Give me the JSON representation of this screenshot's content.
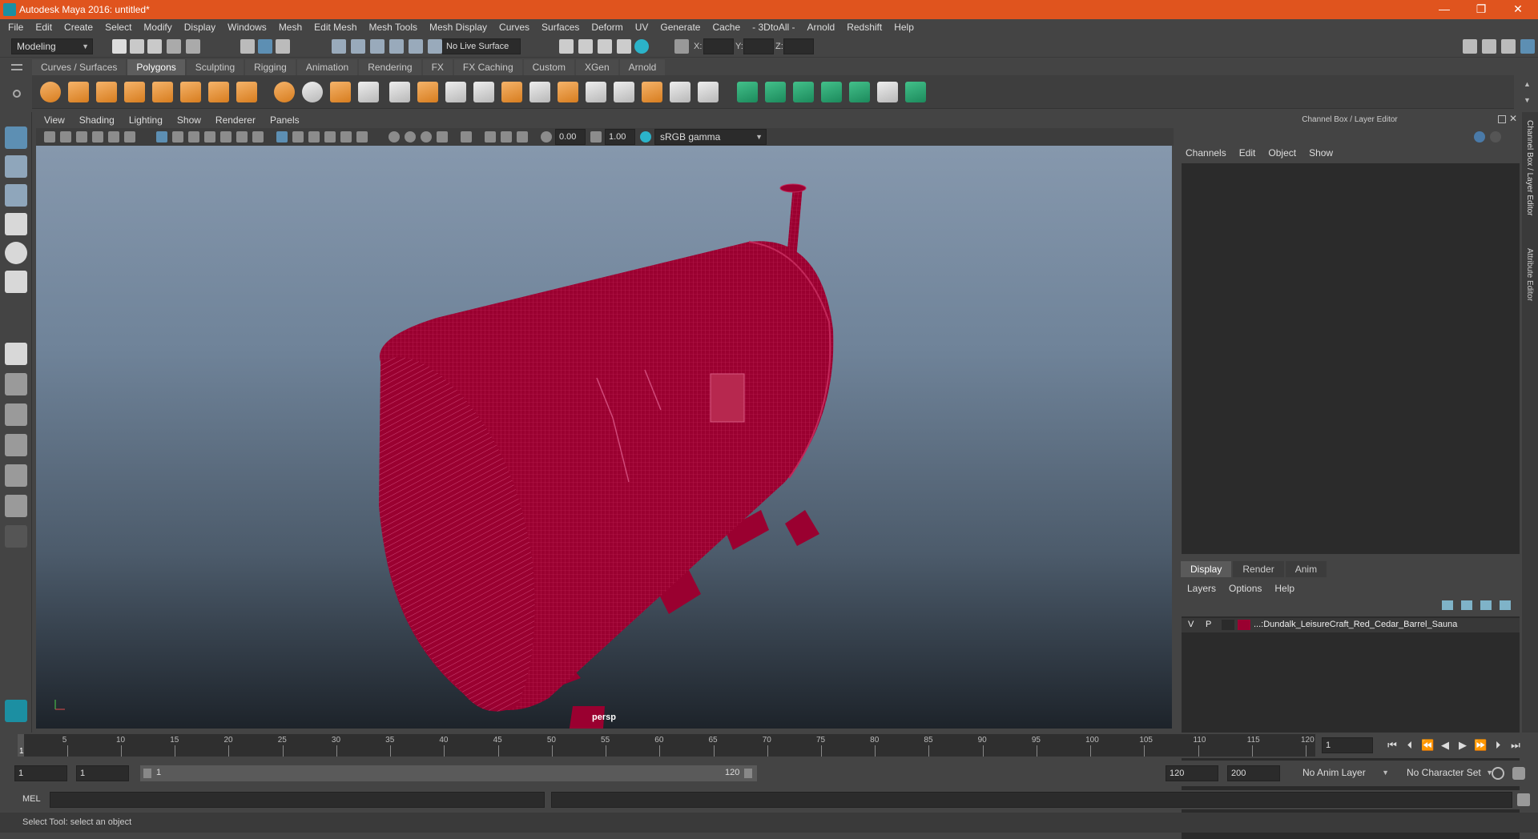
{
  "window": {
    "title": "Autodesk Maya 2016: untitled*",
    "minimize": "—",
    "restore": "❐",
    "close": "✕"
  },
  "menubar": [
    "File",
    "Edit",
    "Create",
    "Select",
    "Modify",
    "Display",
    "Windows",
    "Mesh",
    "Edit Mesh",
    "Mesh Tools",
    "Mesh Display",
    "Curves",
    "Surfaces",
    "Deform",
    "UV",
    "Generate",
    "Cache",
    "- 3DtoAll -",
    "Arnold",
    "Redshift",
    "Help"
  ],
  "statusline": {
    "mode": "Modeling",
    "live_surface": "No Live Surface",
    "x_label": "X:",
    "y_label": "Y:",
    "z_label": "Z:"
  },
  "shelf_tabs": [
    "Curves / Surfaces",
    "Polygons",
    "Sculpting",
    "Rigging",
    "Animation",
    "Rendering",
    "FX",
    "FX Caching",
    "Custom",
    "XGen",
    "Arnold"
  ],
  "shelf_active": "Polygons",
  "viewport": {
    "menus": [
      "View",
      "Shading",
      "Lighting",
      "Show",
      "Renderer",
      "Panels"
    ],
    "exposure": "0.00",
    "gamma": "1.00",
    "color_space": "sRGB gamma",
    "camera_label": "persp"
  },
  "channel_box": {
    "title": "Channel Box / Layer Editor",
    "menus": [
      "Channels",
      "Edit",
      "Object",
      "Show"
    ]
  },
  "layer_editor": {
    "tabs": [
      "Display",
      "Render",
      "Anim"
    ],
    "active_tab": "Display",
    "menus": [
      "Layers",
      "Options",
      "Help"
    ],
    "layer": {
      "visible": "V",
      "playback": "P",
      "name": "...:Dundalk_LeisureCraft_Red_Cedar_Barrel_Sauna",
      "color": "#9a0030"
    }
  },
  "side_tabs": [
    "Channel Box / Layer Editor",
    "Attribute Editor"
  ],
  "timeslider": {
    "ticks": [
      "5",
      "10",
      "15",
      "20",
      "25",
      "30",
      "35",
      "40",
      "45",
      "50",
      "55",
      "60",
      "65",
      "70",
      "75",
      "80",
      "85",
      "90",
      "95",
      "100",
      "105",
      "110",
      "115",
      "120"
    ],
    "start_tick": "1",
    "current_frame": "1"
  },
  "range": {
    "start": "1",
    "playback_start": "1",
    "slider_start": "1",
    "slider_end": "120",
    "playback_end": "120",
    "end": "200",
    "anim_layer": "No Anim Layer",
    "character_set": "No Character Set"
  },
  "command": {
    "lang": "MEL"
  },
  "help_line": "Select Tool: select an object",
  "colors": {
    "title_bar": "#e0541e",
    "mesh_wire": "#9a0030",
    "accent": "#1c8fa2"
  }
}
